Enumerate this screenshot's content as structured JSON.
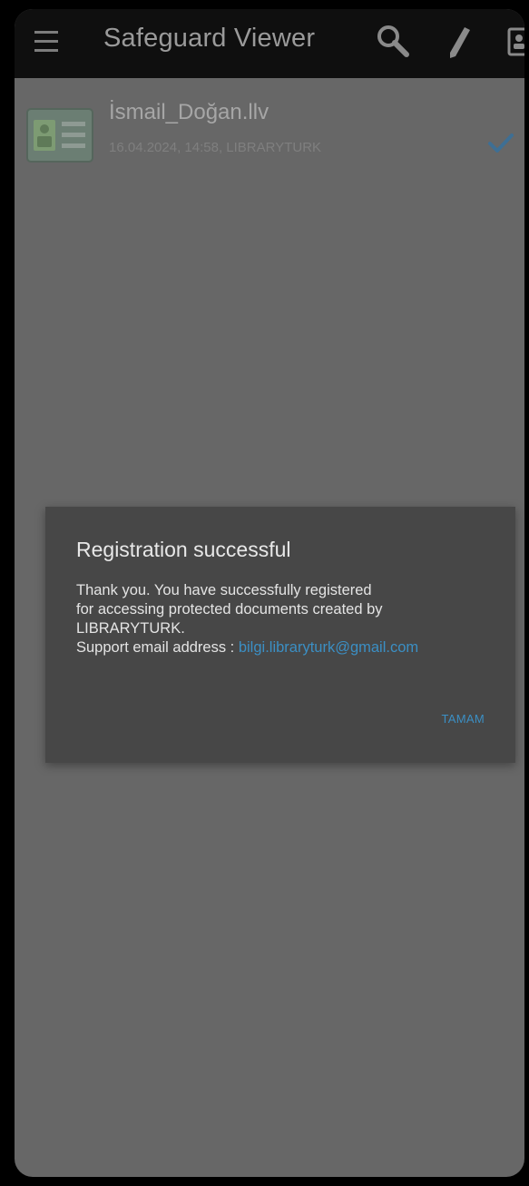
{
  "appbar": {
    "title": "Safeguard Viewer",
    "icons": {
      "menu": "menu-icon",
      "search": "search-icon",
      "edit": "pencil-icon",
      "contact": "contact-card-icon"
    }
  },
  "file": {
    "name": "İsmail_Doğan.llv",
    "meta": "16.04.2024, 14:58, LIBRARYTURK",
    "icon": "id-card-icon",
    "selected_icon": "checkmark-icon"
  },
  "dialog": {
    "title": "Registration successful",
    "line1": "Thank you. You have successfully registered",
    "line2": "for accessing protected documents created by",
    "line3": "LIBRARYTURK.",
    "support_label": "Support email address : ",
    "support_email": "bilgi.libraryturk@gmail.com",
    "ok_label": "TAMAM"
  },
  "colors": {
    "appbar_bg": "#0f0f0f",
    "screen_dim": "#676767",
    "dialog_bg": "#474747",
    "accent": "#3b8fc4"
  }
}
